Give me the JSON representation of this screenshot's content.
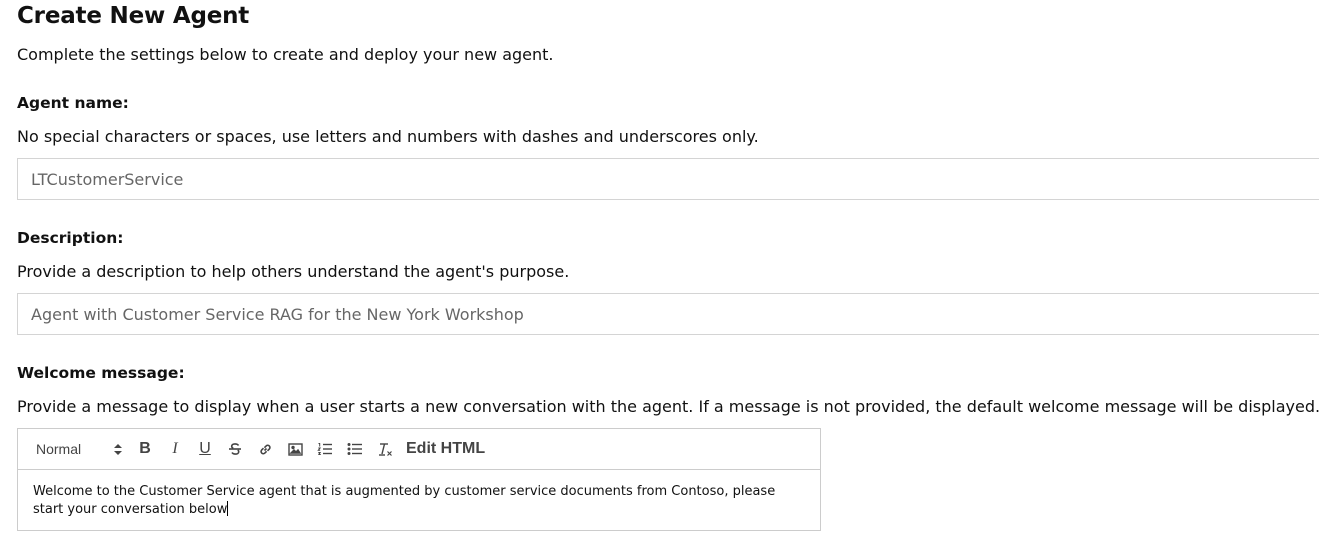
{
  "page": {
    "title": "Create New Agent",
    "subtitle": "Complete the settings below to create and deploy your new agent."
  },
  "agent_name": {
    "label": "Agent name:",
    "help": "No special characters or spaces, use letters and numbers with dashes and underscores only.",
    "value": "LTCustomerService"
  },
  "description": {
    "label": "Description:",
    "help": "Provide a description to help others understand the agent's purpose.",
    "value": "Agent with Customer Service RAG for the New York Workshop"
  },
  "welcome_message": {
    "label": "Welcome message:",
    "help": "Provide a message to display when a user starts a new conversation with the agent. If a message is not provided, the default welcome message will be displayed.",
    "toolbar": {
      "format_select": "Normal",
      "bold": "B",
      "italic": "I",
      "underline": "U",
      "edit_html": "Edit HTML",
      "icons": [
        "strikethrough-icon",
        "link-icon",
        "image-icon",
        "ordered-list-icon",
        "bullet-list-icon",
        "clear-format-icon"
      ]
    },
    "content": "Welcome to the Customer Service agent that is augmented by customer service documents from Contoso, please start your conversation below"
  }
}
